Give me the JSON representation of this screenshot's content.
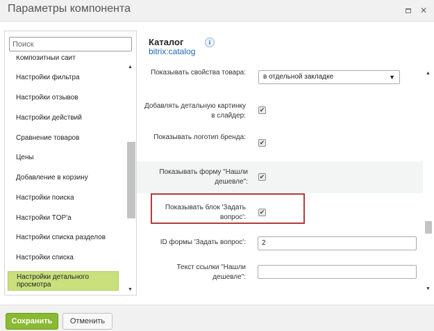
{
  "window": {
    "title": "Параметры компонента"
  },
  "left": {
    "search_placeholder": "Поиск",
    "items": [
      {
        "label": "Композитный сайт"
      },
      {
        "label": "Настройки фильтра"
      },
      {
        "label": "Настройки отзывов"
      },
      {
        "label": "Настройки действий"
      },
      {
        "label": "Сравнение товаров"
      },
      {
        "label": "Цены"
      },
      {
        "label": "Добавление в корзину"
      },
      {
        "label": "Настройки поиска"
      },
      {
        "label": "Настройки TOP'а"
      },
      {
        "label": "Настройки списка разделов"
      },
      {
        "label": "Настройки списка"
      },
      {
        "label": "Настройки детального просмотра"
      }
    ]
  },
  "header": {
    "title": "Каталог",
    "subtitle": "bitrix:catalog",
    "info_icon": "i"
  },
  "properties": [
    {
      "label": "Показывать свойства товара:",
      "type": "select",
      "value": "в отдельной закладке"
    },
    {
      "label": "Добавлять детальную картинку в слайдер:",
      "type": "checkbox",
      "checked": true
    },
    {
      "label": "Показывать логотип бренда:",
      "type": "checkbox",
      "checked": true
    },
    {
      "label": "Показывать форму \"Нашли дешевле\":",
      "type": "checkbox",
      "checked": true
    },
    {
      "label": "Показывать блок 'Задать вопрос':",
      "type": "checkbox",
      "checked": true
    },
    {
      "label": "ID формы 'Задать вопрос':",
      "type": "text",
      "value": "2"
    },
    {
      "label": "Текст ссылки \"Нашли дешевле\":",
      "type": "text",
      "value": ""
    }
  ],
  "footer": {
    "save_label": "Сохранить",
    "cancel_label": "Отменить"
  }
}
